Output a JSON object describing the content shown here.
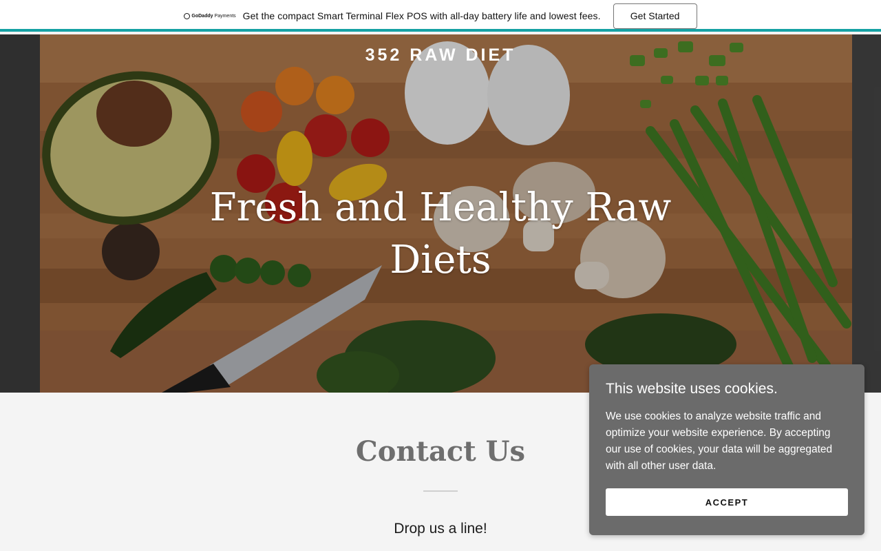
{
  "promo": {
    "logo_brand": "GoDaddy",
    "logo_product": "Payments",
    "text": "Get the compact Smart Terminal Flex POS with all-day battery life and lowest fees.",
    "button": "Get Started",
    "accent_color": "#16a2a4"
  },
  "hero": {
    "site_title": "352 RAW DIET",
    "heading": "Fresh and Healthy Raw Diets"
  },
  "contact": {
    "title": "Contact Us",
    "subtitle": "Drop us a line!"
  },
  "cookie": {
    "title": "This website uses cookies.",
    "text": "We use cookies to analyze website traffic and optimize your website experience. By accepting our use of cookies, your data will be aggregated with all other user data.",
    "accept": "ACCEPT"
  }
}
